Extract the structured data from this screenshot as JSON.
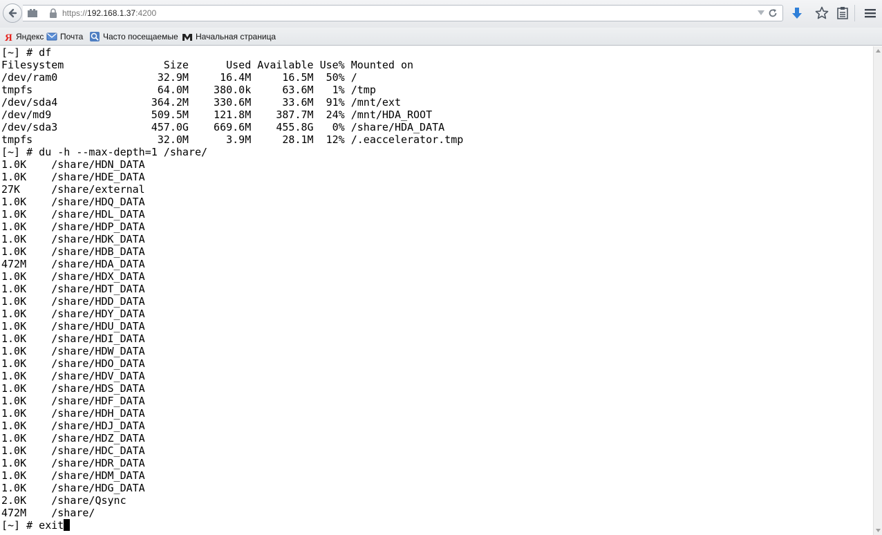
{
  "browser": {
    "url_scheme": "https://",
    "url_host": "192.168.1.37",
    "url_port": ":4200"
  },
  "bookmarks": [
    {
      "label": "Яндекс",
      "icon": "yandex-icon"
    },
    {
      "label": "Почта",
      "icon": "mail-icon"
    },
    {
      "label": "Часто посещаемые",
      "icon": "frequent-icon"
    },
    {
      "label": "Начальная страница",
      "icon": "m-logo-icon"
    }
  ],
  "terminal": {
    "lines": [
      "[~] # df",
      "Filesystem                Size      Used Available Use% Mounted on",
      "/dev/ram0                32.9M     16.4M     16.5M  50% /",
      "tmpfs                    64.0M    380.0k     63.6M   1% /tmp",
      "/dev/sda4               364.2M    330.6M     33.6M  91% /mnt/ext",
      "/dev/md9                509.5M    121.8M    387.7M  24% /mnt/HDA_ROOT",
      "/dev/sda3               457.0G    669.6M    455.8G   0% /share/HDA_DATA",
      "tmpfs                    32.0M      3.9M     28.1M  12% /.eaccelerator.tmp",
      "[~] # du -h --max-depth=1 /share/",
      "1.0K    /share/HDN_DATA",
      "1.0K    /share/HDE_DATA",
      "27K     /share/external",
      "1.0K    /share/HDQ_DATA",
      "1.0K    /share/HDL_DATA",
      "1.0K    /share/HDP_DATA",
      "1.0K    /share/HDK_DATA",
      "1.0K    /share/HDB_DATA",
      "472M    /share/HDA_DATA",
      "1.0K    /share/HDX_DATA",
      "1.0K    /share/HDT_DATA",
      "1.0K    /share/HDD_DATA",
      "1.0K    /share/HDY_DATA",
      "1.0K    /share/HDU_DATA",
      "1.0K    /share/HDI_DATA",
      "1.0K    /share/HDW_DATA",
      "1.0K    /share/HDO_DATA",
      "1.0K    /share/HDV_DATA",
      "1.0K    /share/HDS_DATA",
      "1.0K    /share/HDF_DATA",
      "1.0K    /share/HDH_DATA",
      "1.0K    /share/HDJ_DATA",
      "1.0K    /share/HDZ_DATA",
      "1.0K    /share/HDC_DATA",
      "1.0K    /share/HDR_DATA",
      "1.0K    /share/HDM_DATA",
      "1.0K    /share/HDG_DATA",
      "2.0K    /share/Qsync",
      "472M    /share/"
    ],
    "prompt_line": "[~] # exit"
  }
}
